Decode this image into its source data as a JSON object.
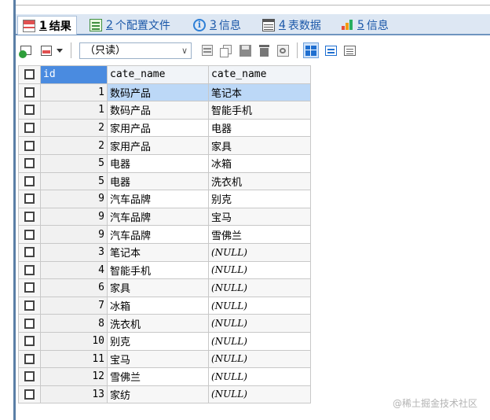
{
  "tabs": [
    {
      "num": "1",
      "label": "结果",
      "icon": "results-grid-icon"
    },
    {
      "num": "2",
      "label": "个配置文件",
      "icon": "profile-icon"
    },
    {
      "num": "3",
      "label": "信息",
      "icon": "info-icon"
    },
    {
      "num": "4",
      "label": "表数据",
      "icon": "table-data-icon"
    },
    {
      "num": "5",
      "label": "信息",
      "icon": "bar-chart-icon"
    }
  ],
  "toolbar": {
    "mode_select": "（只读）",
    "dropdown_arrow": "∨"
  },
  "grid": {
    "columns": [
      "id",
      "cate_name",
      "cate_name"
    ],
    "rows": [
      [
        "1",
        "数码产品",
        "笔记本"
      ],
      [
        "1",
        "数码产品",
        "智能手机"
      ],
      [
        "2",
        "家用产品",
        "电器"
      ],
      [
        "2",
        "家用产品",
        "家具"
      ],
      [
        "5",
        "电器",
        "冰箱"
      ],
      [
        "5",
        "电器",
        "洗衣机"
      ],
      [
        "9",
        "汽车品牌",
        "别克"
      ],
      [
        "9",
        "汽车品牌",
        "宝马"
      ],
      [
        "9",
        "汽车品牌",
        "雪佛兰"
      ],
      [
        "3",
        "笔记本",
        "(NULL)"
      ],
      [
        "4",
        "智能手机",
        "(NULL)"
      ],
      [
        "6",
        "家具",
        "(NULL)"
      ],
      [
        "7",
        "冰箱",
        "(NULL)"
      ],
      [
        "8",
        "洗衣机",
        "(NULL)"
      ],
      [
        "10",
        "别克",
        "(NULL)"
      ],
      [
        "11",
        "宝马",
        "(NULL)"
      ],
      [
        "12",
        "雪佛兰",
        "(NULL)"
      ],
      [
        "13",
        "家纺",
        "(NULL)"
      ]
    ],
    "selected_row": 0
  },
  "watermark": "@稀土掘金技术社区",
  "colors": {
    "accent": "#4a8be0",
    "selection": "#bcd8f7",
    "tab_bar": "#dde7f3"
  }
}
